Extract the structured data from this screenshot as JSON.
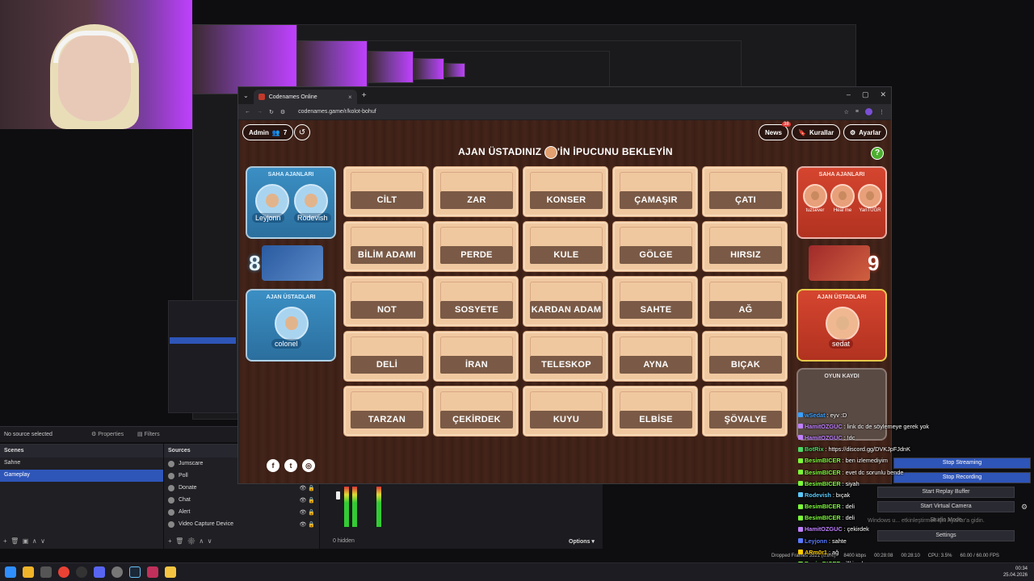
{
  "browser": {
    "tab_title": "Codenames Online",
    "url": "codenames.game/r/kolot-bohuf"
  },
  "game": {
    "admin_label": "Admin",
    "player_count": "7",
    "news_label": "News",
    "news_badge": "38",
    "rules_label": "Kurallar",
    "settings_label": "Ayarlar",
    "headline_left": "AJAN ÜSTADINIZ",
    "headline_right": "'İN İPUCUNU BEKLEYİN",
    "help_label": "?",
    "blue": {
      "operatives_title": "SAHA AJANLARI",
      "operatives": [
        "Leyjonn",
        "Rodevish"
      ],
      "score": "8",
      "spymasters_title": "AJAN ÜSTADLARI",
      "spymaster": "colonel"
    },
    "red": {
      "operatives_title": "SAHA AJANLARI",
      "operatives": [
        "tuzsever",
        "Heal me",
        "YanTUĞR"
      ],
      "score": "9",
      "spymasters_title": "AJAN ÜSTADLARI",
      "spymaster": "sedat"
    },
    "log_title": "OYUN KAYDI",
    "cards": [
      [
        "CİLT",
        "ZAR",
        "KONSER",
        "ÇAMAŞIR",
        "ÇATI"
      ],
      [
        "BİLİM ADAMI",
        "PERDE",
        "KULE",
        "GÖLGE",
        "HIRSIZ"
      ],
      [
        "NOT",
        "SOSYETE",
        "KARDAN ADAM",
        "SAHTE",
        "AĞ"
      ],
      [
        "DELİ",
        "İRAN",
        "TELESKOP",
        "AYNA",
        "BIÇAK"
      ],
      [
        "TARZAN",
        "ÇEKİRDEK",
        "KUYU",
        "ELBİSE",
        "ŞÖVALYE"
      ]
    ]
  },
  "obs": {
    "no_source": "No source selected",
    "properties_label": "Properties",
    "filters_label": "Filters",
    "scenes_title": "Scenes",
    "scenes": [
      "Sahne",
      "Gameplay"
    ],
    "sources_title": "Sources",
    "sources": [
      "Jumscare",
      "Poll",
      "Donate",
      "Chat",
      "Alert",
      "Video Capture Device",
      "Display Capture"
    ],
    "hidden_label": "0 hidden",
    "options_label": "Options",
    "controls": [
      "Stop Streaming",
      "Stop Recording",
      "Start Replay Buffer",
      "Start Virtual Camera",
      "Studio Mode",
      "Settings"
    ],
    "status": {
      "dropped": "Dropped Frames 3521 (0.8%)",
      "kbps": "8400 kbps",
      "stream_time": "00:28:08",
      "rec_time": "00:28:10",
      "cpu": "CPU: 3.5%",
      "fps": "60.00 / 60.00 FPS"
    },
    "windows_watermark": "Windows u... etkinleştirmek için Ayarlar'a gidin."
  },
  "chat": [
    {
      "user": "wSedat",
      "msg": "eyv :D",
      "color": "#3aa0ff"
    },
    {
      "user": "HamitOZGUC",
      "msg": "link dc de söylemeye gerek yok",
      "color": "#c080ff"
    },
    {
      "user": "HamitOZGUC",
      "msg": "!dc",
      "color": "#c080ff"
    },
    {
      "user": "BotRix",
      "msg": "https://discord.gg/DVKJpFJdnK",
      "color": "#4cd964"
    },
    {
      "user": "BesimBICER",
      "msg": "ben izlemediyim",
      "color": "#7cfc3a"
    },
    {
      "user": "BesimBICER",
      "msg": "evet dc sorunlu bende",
      "color": "#7cfc3a"
    },
    {
      "user": "BesimBICER",
      "msg": "siyah",
      "color": "#7cfc3a"
    },
    {
      "user": "Rodevish",
      "msg": "bıçak",
      "color": "#5ac8fa"
    },
    {
      "user": "BesimBICER",
      "msg": "deli",
      "color": "#7cfc3a"
    },
    {
      "user": "BesimBICER",
      "msg": "deli",
      "color": "#7cfc3a"
    },
    {
      "user": "HamitOZGUC",
      "msg": "çekirdek",
      "color": "#c080ff"
    },
    {
      "user": "Leyjonn",
      "msg": "sahte",
      "color": "#5a7aff"
    },
    {
      "user": "ARm0r1",
      "msg": "ağ",
      "color": "#ffcc00"
    },
    {
      "user": "BesimBICER",
      "msg": "illki yok o",
      "color": "#7cfc3a"
    },
    {
      "user": "BesimBICER",
      "msg": "ben deli seçtim",
      "color": "#7cfc3a"
    }
  ],
  "taskbar": {
    "time": "00:34",
    "date": "25.04.2026"
  }
}
